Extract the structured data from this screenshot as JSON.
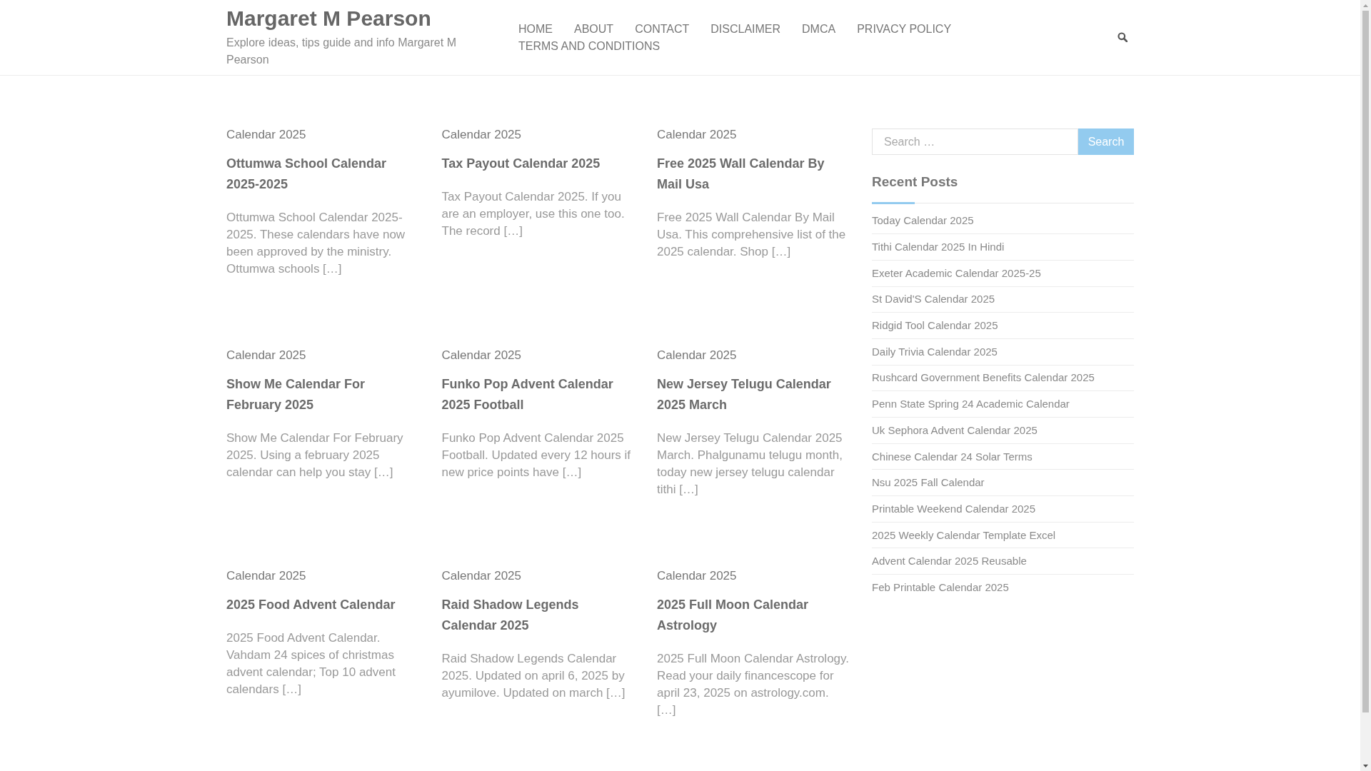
{
  "header": {
    "site_title": "Margaret M Pearson",
    "tagline": "Explore ideas, tips guide and info Margaret M Pearson",
    "nav": [
      "HOME",
      "ABOUT",
      "CONTACT",
      "DISCLAIMER",
      "DMCA",
      "PRIVACY POLICY",
      "TERMS AND CONDITIONS"
    ]
  },
  "posts": [
    {
      "category": "Calendar 2025",
      "title": "Ottumwa School Calendar 2025-2025",
      "excerpt": "Ottumwa School Calendar 2025-2025. These calendars have now been approved by the ministry. Ottumwa schools […]"
    },
    {
      "category": "Calendar 2025",
      "title": "Tax Payout Calendar 2025",
      "excerpt": "Tax Payout Calendar 2025. If you are an employer, use this one too. The record […]"
    },
    {
      "category": "Calendar 2025",
      "title": "Free 2025 Wall Calendar By Mail Usa",
      "excerpt": "Free 2025 Wall Calendar By Mail Usa. This comprehensive list of the 2025 calendar. Shop […]"
    },
    {
      "category": "Calendar 2025",
      "title": "Show Me Calendar For February 2025",
      "excerpt": "Show Me Calendar For February 2025. Using a february 2025 calendar can help you stay […]"
    },
    {
      "category": "Calendar 2025",
      "title": "Funko Pop Advent Calendar 2025 Football",
      "excerpt": "Funko Pop Advent Calendar 2025 Football. Updated every 12 hours if new price points have […]"
    },
    {
      "category": "Calendar 2025",
      "title": "New Jersey Telugu Calendar 2025 March",
      "excerpt": "New Jersey Telugu Calendar 2025 March. Phalgunamu telugu month, today new jersey telugu calendar tithi […]"
    },
    {
      "category": "Calendar 2025",
      "title": "2025 Food Advent Calendar",
      "excerpt": "2025 Food Advent Calendar. Vahdam 24 spices of christmas advent calendar; Top 10 advent calendars […]"
    },
    {
      "category": "Calendar 2025",
      "title": "Raid Shadow Legends Calendar 2025",
      "excerpt": "Raid Shadow Legends Calendar 2025. Updated on april 6, 2025 by ayumilove. Updated on march […]"
    },
    {
      "category": "Calendar 2025",
      "title": "2025 Full Moon Calendar Astrology",
      "excerpt": "2025 Full Moon Calendar Astrology. Read your daily financescope for april 23, 2025 on astrology.com. […]"
    }
  ],
  "sidebar": {
    "search": {
      "placeholder": "Search …",
      "button": "Search"
    },
    "recent_posts": {
      "title": "Recent Posts",
      "items": [
        "Today Calendar 2025",
        "Tithi Calendar 2025 In Hindi",
        "Exeter Academic Calendar 2025-25",
        "St David'S Calendar 2025",
        "Ridgid Tool Calendar 2025",
        "Daily Trivia Calendar 2025",
        "Rushcard Government Benefits Calendar 2025",
        "Penn State Spring 24 Academic Calendar",
        "Uk Sephora Advent Calendar 2025",
        "Chinese Calendar 24 Solar Terms",
        "Nsu 2025 Fall Calendar",
        "Printable Weekend Calendar 2025",
        "2025 Weekly Calendar Template Excel",
        "Advent Calendar 2025 Reusable",
        "Feb Printable Calendar 2025"
      ]
    }
  }
}
